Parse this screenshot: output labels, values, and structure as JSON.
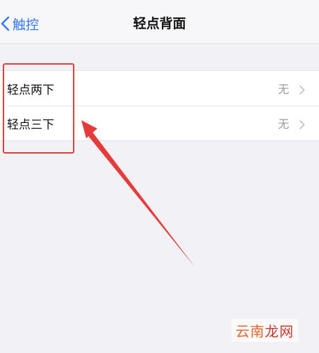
{
  "navbar": {
    "back_label": "触控",
    "title": "轻点背面"
  },
  "rows": [
    {
      "label": "轻点两下",
      "value": "无"
    },
    {
      "label": "轻点三下",
      "value": "无"
    }
  ],
  "annotation": {
    "color": "#e63b3b"
  },
  "watermark": {
    "part1": "云南",
    "part2": "龙网"
  },
  "colors": {
    "accent": "#3478f6",
    "background": "#f2f2f6"
  }
}
